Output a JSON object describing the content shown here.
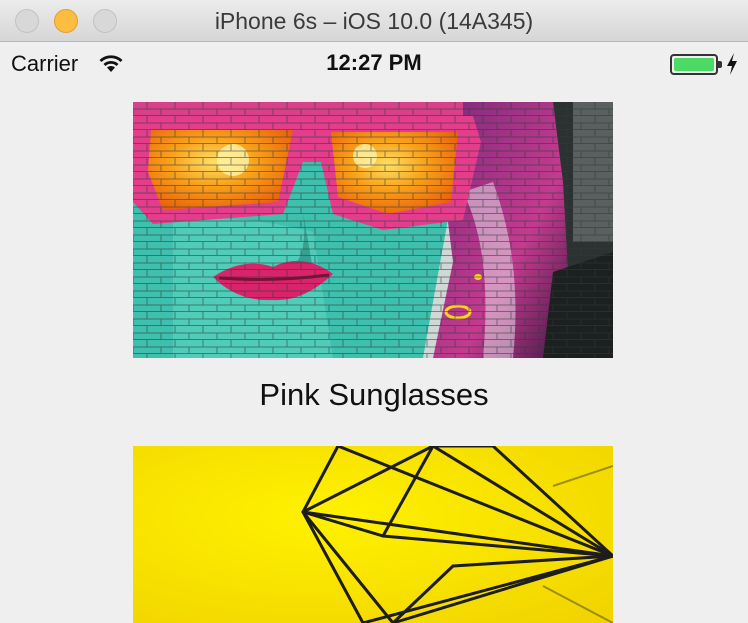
{
  "window": {
    "title": "iPhone 6s – iOS 10.0 (14A345)"
  },
  "status_bar": {
    "carrier": "Carrier",
    "time": "12:27 PM",
    "battery_charging": true
  },
  "cards": [
    {
      "title": "Pink Sunglasses",
      "image": "graffiti-woman-pink-sunglasses"
    },
    {
      "title": "",
      "image": "geometric-wire-on-yellow"
    }
  ],
  "colors": {
    "battery_fill": "#4cd964",
    "minimize_button": "#fdbd40"
  }
}
